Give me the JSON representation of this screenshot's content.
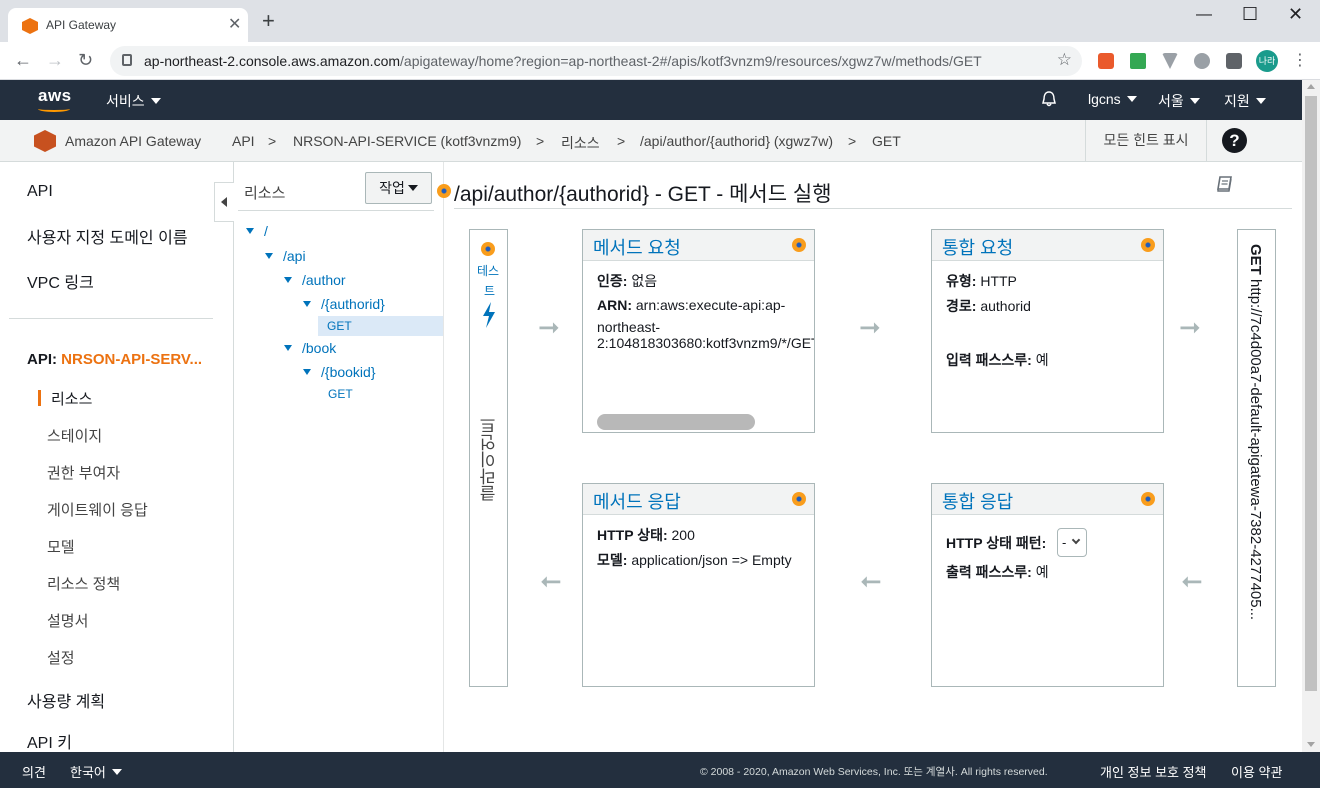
{
  "browser": {
    "tab_title": "API Gateway",
    "url_prefix": "ap-northeast-2.console.aws.amazon.com",
    "url_path": "/apigateway/home?region=ap-northeast-2#/apis/kotf3vnzm9/resources/xgwz7w/methods/GET",
    "profile_label": "나라"
  },
  "awsnav": {
    "logo": "aws",
    "services": "서비스",
    "account": "lgcns",
    "region": "서울",
    "support": "지원"
  },
  "breadcrumb": {
    "service": "Amazon API Gateway",
    "items": [
      "API",
      "NRSON-API-SERVICE (kotf3vnzm9)",
      "리소스",
      "/api/author/{authorid} (xgwz7w)",
      "GET"
    ],
    "separator": ">",
    "hints_button": "모든 힌트 표시",
    "help": "?"
  },
  "sidebar": {
    "top_items": [
      "API",
      "사용자 지정 도메인 이름",
      "VPC 링크"
    ],
    "api_prefix": "API:",
    "api_name": "NRSON-API-SERV...",
    "sub_items": [
      "리소스",
      "스테이지",
      "권한 부여자",
      "게이트웨이 응답",
      "모델",
      "리소스 정책",
      "설명서",
      "설정"
    ],
    "bottom_items": [
      "사용량 계획",
      "API 키"
    ]
  },
  "tree": {
    "header": "리소스",
    "actions_button": "작업",
    "nodes": [
      "/",
      "/api",
      "/author",
      "/{authorid}",
      "GET",
      "/book",
      "/{bookid}",
      "GET"
    ]
  },
  "main": {
    "title": "/api/author/{authorid} - GET - 메서드 실행",
    "client": {
      "test_label_1": "테스",
      "test_label_2": "트",
      "client_label": "클라이언트"
    },
    "method_request": {
      "title": "메서드 요청",
      "auth_label": "인증:",
      "auth_value": "없음",
      "arn_label": "ARN:",
      "arn_line1": "arn:aws:execute-api:ap-",
      "arn_line2": "northeast-",
      "arn_line3": "2:104818303680:kotf3vnzm9/*/GET"
    },
    "integration_request": {
      "title": "통합 요청",
      "type_label": "유형:",
      "type_value": "HTTP",
      "path_label": "경로:",
      "path_value": "authorid",
      "passthrough_label": "입력 패스스루:",
      "passthrough_value": "예"
    },
    "method_response": {
      "title": "메서드 응답",
      "status_label": "HTTP 상태:",
      "status_value": "200",
      "model_label": "모델:",
      "model_value": "application/json => Empty"
    },
    "integration_response": {
      "title": "통합 응답",
      "pattern_label": "HTTP 상태 패턴:",
      "pattern_value": "-",
      "passthrough_label": "출력 패스스루:",
      "passthrough_value": "예"
    },
    "endpoint": {
      "method": "GET",
      "url": "http://7c4d00a7-default-apigatewa-7382-4277405..."
    }
  },
  "footer": {
    "feedback": "의견",
    "language": "한국어",
    "copyright": "© 2008 - 2020, Amazon Web Services, Inc. 또는 계열사. All rights reserved.",
    "privacy": "개인 정보 보호 정책",
    "terms": "이용 약관"
  },
  "colors": {
    "aws_nav": "#232f3e",
    "link": "#0073bb",
    "api_name": "#ec7211",
    "accent_orange": "#f99d1c"
  }
}
